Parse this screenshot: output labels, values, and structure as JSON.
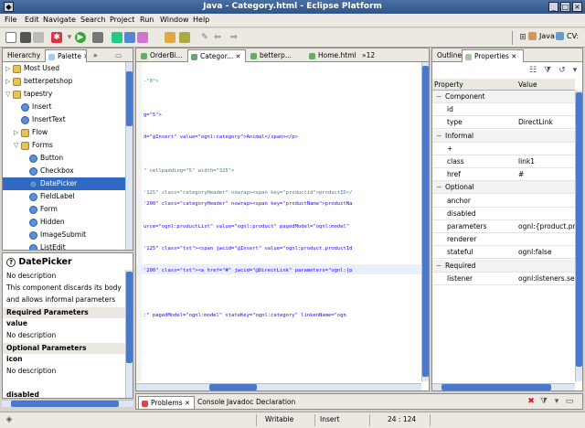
{
  "window": {
    "title": "Java - Category.html - Eclipse Platform"
  },
  "menu": [
    "File",
    "Edit",
    "Navigate",
    "Search",
    "Project",
    "Run",
    "Window",
    "Help"
  ],
  "perspective": {
    "java": "Java",
    "cvs": "CV:"
  },
  "left_tabs": {
    "hierarchy": "Hierarchy",
    "palette": "Palette",
    "overflow": "»"
  },
  "palette": [
    {
      "label": "Most Used",
      "type": "folder",
      "indent": 0,
      "twisty": "▷"
    },
    {
      "label": "betterpetshop",
      "type": "folder",
      "indent": 0,
      "twisty": "▷"
    },
    {
      "label": "tapestry",
      "type": "folder",
      "indent": 0,
      "twisty": "▽"
    },
    {
      "label": "Insert",
      "type": "comp",
      "indent": 1,
      "twisty": ""
    },
    {
      "label": "InsertText",
      "type": "comp",
      "indent": 1,
      "twisty": ""
    },
    {
      "label": "Flow",
      "type": "folder",
      "indent": 1,
      "twisty": "▷"
    },
    {
      "label": "Forms",
      "type": "folder",
      "indent": 1,
      "twisty": "▽"
    },
    {
      "label": "Button",
      "type": "comp",
      "indent": 2,
      "twisty": ""
    },
    {
      "label": "Checkbox",
      "type": "comp",
      "indent": 2,
      "twisty": ""
    },
    {
      "label": "DatePicker",
      "type": "comp",
      "indent": 2,
      "twisty": "",
      "selected": true
    },
    {
      "label": "FieldLabel",
      "type": "comp",
      "indent": 2,
      "twisty": ""
    },
    {
      "label": "Form",
      "type": "comp",
      "indent": 2,
      "twisty": ""
    },
    {
      "label": "Hidden",
      "type": "comp",
      "indent": 2,
      "twisty": ""
    },
    {
      "label": "ImageSubmit",
      "type": "comp",
      "indent": 2,
      "twisty": ""
    },
    {
      "label": "ListEdit",
      "type": "comp",
      "indent": 2,
      "twisty": ""
    }
  ],
  "doc": {
    "title": "DatePicker",
    "lines": [
      {
        "text": "No description",
        "style": "normal"
      },
      {
        "text": "This component discards its body",
        "style": "normal"
      },
      {
        "text": "and allows informal parameters",
        "style": "normal"
      },
      {
        "text": "Required Parameters",
        "style": "head"
      },
      {
        "text": "value",
        "style": "bold"
      },
      {
        "text": "No description",
        "style": "normal"
      },
      {
        "text": "Optional Parameters",
        "style": "head"
      },
      {
        "text": "icon",
        "style": "bold"
      },
      {
        "text": "No description",
        "style": "normal"
      },
      {
        "text": "",
        "style": "normal"
      },
      {
        "text": "disabled",
        "style": "bold"
      },
      {
        "text": "No description",
        "style": "normal"
      }
    ]
  },
  "editor_tabs": [
    {
      "label": "OrderBi...",
      "active": false
    },
    {
      "label": "Categor...",
      "active": true
    },
    {
      "label": "betterp...",
      "active": false
    },
    {
      "label": "Home.html",
      "active": false
    },
    {
      "label": "»12",
      "active": false
    }
  ],
  "code_lines": [
    {
      "text": "-\"0\">"
    },
    {
      "text": ""
    },
    {
      "text": ""
    },
    {
      "text": "g=\"5\">"
    },
    {
      "text": ""
    },
    {
      "text": "d=\"@Insert\" value=\"ognl:category\">Animal</span></p>"
    },
    {
      "text": ""
    },
    {
      "text": ""
    },
    {
      "text": "\" cellpadding=\"5\" width=\"325\">"
    },
    {
      "text": ""
    },
    {
      "text": "'125\" class=\"categoryHeader\" nowrap><span key=\"productid\">productID</"
    },
    {
      "text": "'200\" class=\"categoryHeader\" nowrap><span key=\"productName\">productNa"
    },
    {
      "text": ""
    },
    {
      "text": "urce=\"ognl:productList\" value=\"ognl:product\" pagedModel=\"ognl:model\""
    },
    {
      "text": ""
    },
    {
      "text": "'125\" class=\"txt\"><span jwcid=\"@Insert\" value=\"ognl:product.productId"
    },
    {
      "text": ""
    },
    {
      "text": "'200\" class=\"txt\"><a href=\"#\" jwcid=\"@DirectLink\" parameters=\"ognl:{p"
    },
    {
      "text": ""
    },
    {
      "text": ""
    },
    {
      "text": ""
    },
    {
      "text": ":\" pagedModel=\"ognl:model\" stateKey=\"ognl:category\" linkenName=\"ogn"
    }
  ],
  "right_tabs": {
    "outline": "Outline",
    "properties": "Properties"
  },
  "properties": {
    "header": {
      "property": "Property",
      "value": "Value"
    },
    "rows": [
      {
        "key": "Component",
        "value": "",
        "level": 0,
        "cat": true
      },
      {
        "key": "id",
        "value": "",
        "level": 1
      },
      {
        "key": "type",
        "value": "DirectLink",
        "level": 1
      },
      {
        "key": "Informal",
        "value": "",
        "level": 0,
        "cat": true
      },
      {
        "key": "+",
        "value": "",
        "level": 1
      },
      {
        "key": "class",
        "value": "link1",
        "level": 1
      },
      {
        "key": "href",
        "value": "#",
        "level": 1
      },
      {
        "key": "Optional",
        "value": "",
        "level": 0,
        "cat": true
      },
      {
        "key": "anchor",
        "value": "",
        "level": 1
      },
      {
        "key": "disabled",
        "value": "",
        "level": 1
      },
      {
        "key": "parameters",
        "value": "ognl:{product.prod",
        "level": 1
      },
      {
        "key": "renderer",
        "value": "",
        "level": 1
      },
      {
        "key": "stateful",
        "value": "ognl:false",
        "level": 1
      },
      {
        "key": "Required",
        "value": "",
        "level": 0,
        "cat": true
      },
      {
        "key": "listener",
        "value": "ognl:listeners.selec",
        "level": 1
      }
    ]
  },
  "bottom_tabs": [
    "Problems",
    "Console",
    "Javadoc",
    "Declaration"
  ],
  "status": {
    "writable": "Writable",
    "insert": "Insert",
    "position": "24 : 124"
  },
  "colors": {
    "selection": "#316ac5",
    "code_blue": "#2a00ff",
    "code_teal": "#008080",
    "code_tag": "#3f7f7f"
  }
}
